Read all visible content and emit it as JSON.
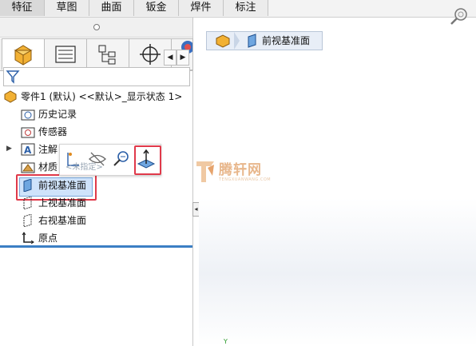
{
  "command_tabs": [
    "特征",
    "草图",
    "曲面",
    "钣金",
    "焊件",
    "标注"
  ],
  "pane_tabs": [
    "part-icon",
    "property-manager-icon",
    "configuration-manager-icon",
    "dim-xpert-icon",
    "display-manager-icon"
  ],
  "scroll_left": "◀",
  "scroll_right": "▶",
  "tree": {
    "root_label": "零件1 (默认) <<默认>_显示状态 1>",
    "items": [
      {
        "label": "历史记录",
        "icon": "history-folder-icon"
      },
      {
        "label": "传感器",
        "icon": "sensors-icon"
      },
      {
        "label": "注解",
        "icon": "annotations-icon"
      },
      {
        "label": "材质",
        "icon": "material-icon"
      },
      {
        "label": "前视基准面",
        "icon": "plane-icon"
      },
      {
        "label": "上视基准面",
        "icon": "plane-icon"
      },
      {
        "label": "右视基准面",
        "icon": "plane-icon"
      },
      {
        "label": "原点",
        "icon": "origin-icon"
      }
    ],
    "expand_glyph": "▶"
  },
  "context_toolbar": {
    "ghost_text": "<未指定>",
    "buttons": [
      "sketch-icon",
      "hide-icon",
      "zoom-to-selection-icon",
      "normal-to-icon"
    ]
  },
  "splitter_glyph": "◂",
  "graphics": {
    "breadcrumb_label": "前视基准面",
    "watermark_text": "腾轩网",
    "watermark_sub": "TENGXUANWANG.COM",
    "axis_label": "Y"
  },
  "colors": {
    "selection_red": "#e0394a",
    "selection_fill": "#cfe3fb",
    "pane_accent": "#3b7fc4",
    "part_icon": "#f2b134"
  }
}
